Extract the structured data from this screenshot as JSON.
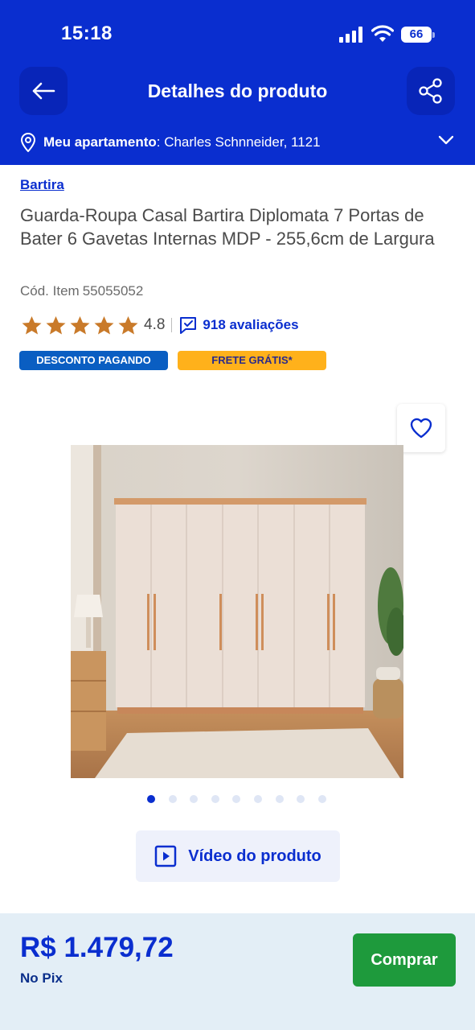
{
  "status_bar": {
    "time": "15:18",
    "battery": "66",
    "icons": [
      "cellular-signal-icon",
      "wifi-icon",
      "battery-icon"
    ]
  },
  "header": {
    "title": "Detalhes do produto",
    "back_icon": "arrow-left-icon",
    "share_icon": "share-icon",
    "color": "#0a2ecf"
  },
  "location": {
    "label": "Meu apartamento",
    "address": ": Charles Schnneider, 1121",
    "icon": "location-pin-icon",
    "expand_icon": "chevron-down-icon"
  },
  "product": {
    "brand": "Bartira",
    "title": "Guarda-Roupa Casal Bartira Diplomata 7 Portas de Bater 6 Gavetas Internas MDP - 255,6cm de Largura",
    "code_label": "Cód. Item",
    "code": "55055052",
    "rating": "4.8",
    "stars": 5,
    "reviews": "918 avaliações",
    "badges": {
      "discount": "DESCONTO PAGANDO",
      "shipping": "FRETE GRÁTIS*"
    },
    "favorite_icon": "heart-icon"
  },
  "gallery": {
    "total_images": 9,
    "active_index": 0
  },
  "video_button": {
    "label": "Vídeo do produto",
    "icon": "play-icon"
  },
  "purchase": {
    "price": "R$ 1.479,72",
    "payment_method": "No Pix",
    "buy_label": "Comprar",
    "buy_color": "#1e9a3c"
  }
}
